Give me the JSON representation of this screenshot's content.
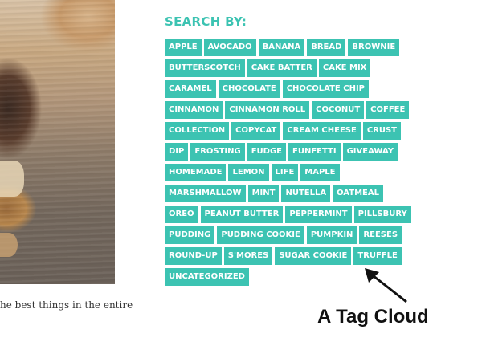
{
  "sidebar": {
    "heading": "SEARCH BY:",
    "tags": [
      "APPLE",
      "AVOCADO",
      "BANANA",
      "BREAD",
      "BROWNIE",
      "BUTTERSCOTCH",
      "CAKE BATTER",
      "CAKE MIX",
      "CARAMEL",
      "CHOCOLATE",
      "CHOCOLATE CHIP",
      "CINNAMON",
      "CINNAMON ROLL",
      "COCONUT",
      "COFFEE",
      "COLLECTION",
      "COPYCAT",
      "CREAM CHEESE",
      "CRUST",
      "DIP",
      "FROSTING",
      "FUDGE",
      "FUNFETTI",
      "GIVEAWAY",
      "HOMEMADE",
      "LEMON",
      "LIFE",
      "MAPLE",
      "MARSHMALLOW",
      "MINT",
      "NUTELLA",
      "OATMEAL",
      "OREO",
      "PEANUT BUTTER",
      "PEPPERMINT",
      "PILLSBURY",
      "PUDDING",
      "PUDDING COOKIE",
      "PUMPKIN",
      "REESES",
      "ROUND-UP",
      "S'MORES",
      "SUGAR COOKIE",
      "TRUFFLE",
      "UNCATEGORIZED"
    ]
  },
  "post": {
    "caption": "he best things in the entire"
  },
  "annotation": {
    "label": "A Tag Cloud"
  },
  "colors": {
    "accent": "#3cc3b2",
    "tag_text": "#ffffff"
  }
}
